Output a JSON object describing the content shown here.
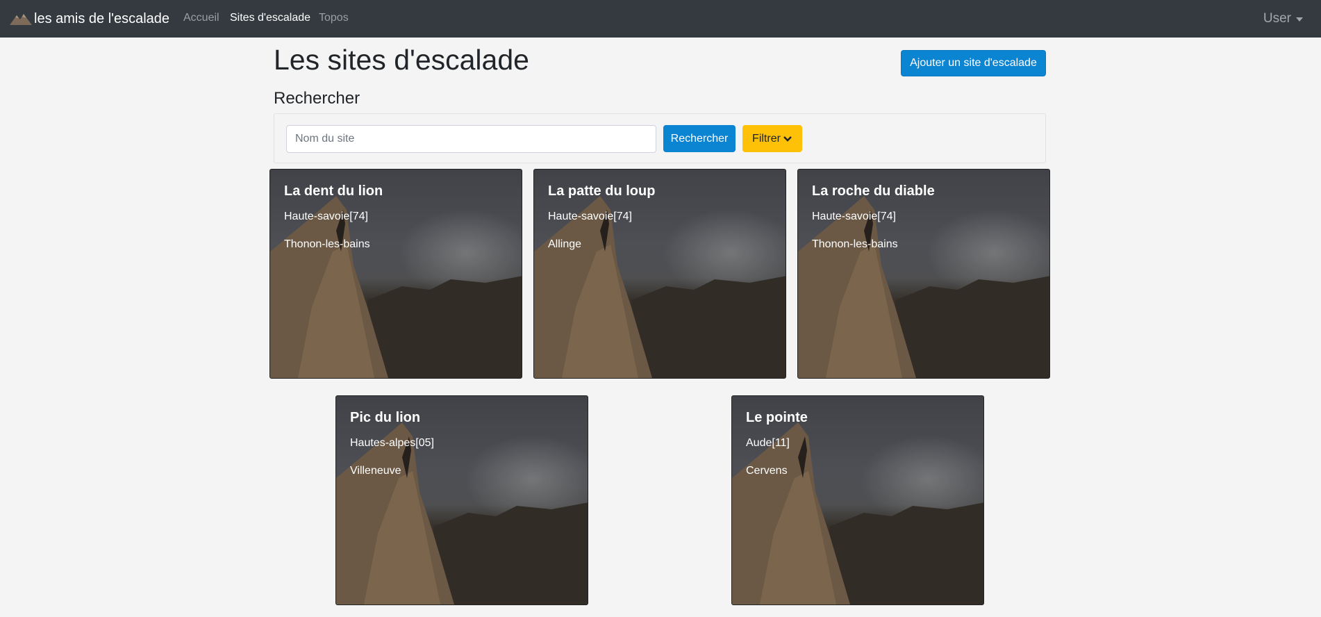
{
  "navbar": {
    "brand": "les amis de l'escalade",
    "links": [
      {
        "label": "Accueil",
        "active": false
      },
      {
        "label": "Sites d'escalade",
        "active": true
      },
      {
        "label": "Topos",
        "active": false
      }
    ],
    "user_label": "User"
  },
  "page": {
    "title": "Les sites d'escalade",
    "add_button": "Ajouter un site d'escalade",
    "search_heading": "Rechercher"
  },
  "search": {
    "placeholder": "Nom du site",
    "value": "",
    "submit_label": "Rechercher",
    "filter_label": "Filtrer"
  },
  "sites": [
    {
      "name": "La dent du lion",
      "department": "Haute-savoie[74]",
      "city": "Thonon-les-bains"
    },
    {
      "name": "La patte du loup",
      "department": "Haute-savoie[74]",
      "city": "Allinge"
    },
    {
      "name": "La roche du diable",
      "department": "Haute-savoie[74]",
      "city": "Thonon-les-bains"
    },
    {
      "name": "Pic du lion",
      "department": "Hautes-alpes[05]",
      "city": "Villeneuve"
    },
    {
      "name": "Le pointe",
      "department": "Aude[11]",
      "city": "Cervens"
    }
  ],
  "colors": {
    "navbar_bg": "#343a40",
    "primary": "#0b84d2",
    "warning": "#ffc107",
    "page_bg": "#f4f4f4"
  },
  "icons": {
    "brand": "mountain-logo-icon",
    "user_caret": "caret-down-icon",
    "filter": "chevron-down-icon",
    "card_image": "climber-photo"
  }
}
